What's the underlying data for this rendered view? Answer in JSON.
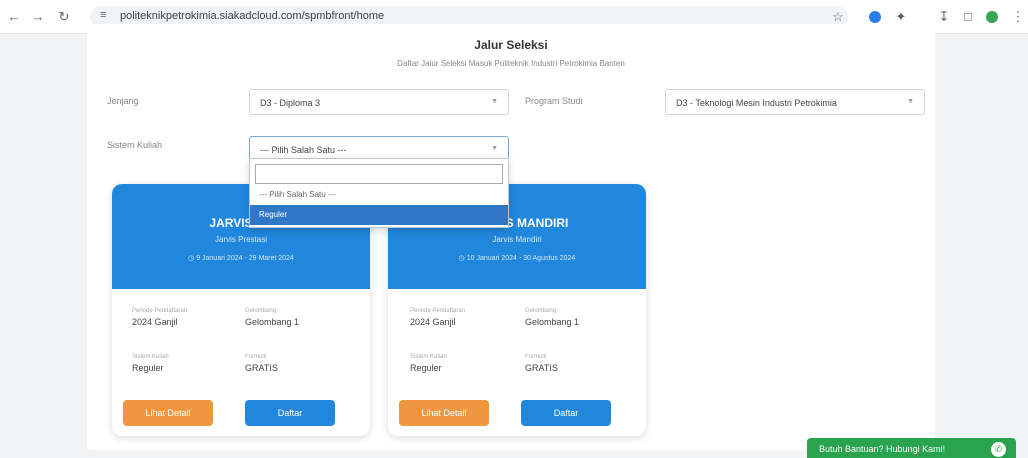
{
  "browser": {
    "url": "politeknikpetrokimia.siakadcloud.com/spmbfront/home"
  },
  "page": {
    "title": "Jalur Seleksi",
    "subtitle": "Daftar Jalur Seleksi Masuk Politeknik Industri Petrokimia Banten"
  },
  "form": {
    "jenjang_label": "Jenjang",
    "jenjang_value": "D3 - Diploma 3",
    "prodi_label": "Program Studi",
    "prodi_value": "D3 - Teknologi Mesin Industri Petrokimia",
    "sistem_label": "Sistem Kuliah",
    "sistem_value": "--- Pilih Salah Satu ---"
  },
  "dropdown": {
    "search_value": "",
    "options": [
      "--- Pilih Salah Satu ---",
      "Reguler"
    ],
    "highlighted": "Reguler"
  },
  "cards": [
    {
      "name_visible": "JARVIS PR",
      "subtitle": "Jarvis Prestasi",
      "date": "9 Januari 2024 - 29 Maret 2024",
      "periode_label": "Periode Pendaftaran",
      "periode": "2024 Ganjil",
      "gelombang_label": "Gelombang",
      "gelombang": "Gelombang 1",
      "sistem_label": "Sistem Kuliah",
      "sistem": "Reguler",
      "formulir_label": "Formulir",
      "formulir": "GRATIS",
      "detail_label": "Lihat Detail",
      "daftar_label": "Daftar"
    },
    {
      "name_visible": "S MANDIRI",
      "subtitle": "Jarvis Mandiri",
      "date": "10 Januari 2024 - 30 Agustus 2024",
      "periode_label": "Periode Pendaftaran",
      "periode": "2024 Ganjil",
      "gelombang_label": "Gelombang",
      "gelombang": "Gelombang 1",
      "sistem_label": "Sistem Kuliah",
      "sistem": "Reguler",
      "formulir_label": "Formulir",
      "formulir": "GRATIS",
      "detail_label": "Lihat Detail",
      "daftar_label": "Daftar"
    }
  ],
  "help": {
    "label": "Butuh Bantuan? Hubungi Kami!"
  },
  "colors": {
    "primary": "#2087dc",
    "orange": "#f0963f",
    "highlight": "#2f78c8",
    "help_green": "#2aa34f"
  }
}
